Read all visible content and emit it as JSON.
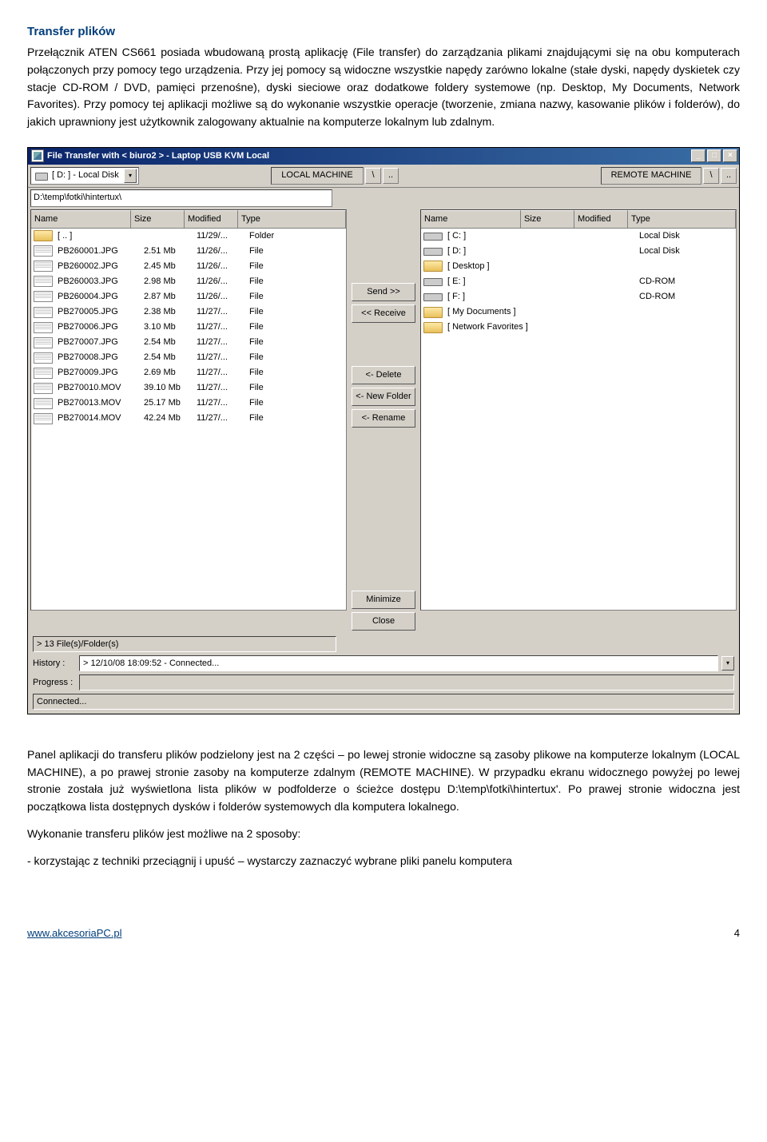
{
  "doc": {
    "heading": "Transfer plików",
    "para1": "Przełącznik ATEN CS661 posiada wbudowaną prostą aplikację (File transfer) do zarządzania plikami znajdującymi się na obu komputerach połączonych przy pomocy tego urządzenia. Przy jej pomocy są widoczne wszystkie napędy zarówno lokalne (stałe dyski, napędy dyskietek czy stacje CD-ROM / DVD, pamięci przenośne), dyski sieciowe oraz dodatkowe foldery systemowe (np. Desktop, My Documents, Network Favorites). Przy pomocy tej aplikacji możliwe są do wykonanie wszystkie operacje (tworzenie, zmiana nazwy, kasowanie plików i folderów), do jakich uprawniony jest użytkownik zalogowany aktualnie na komputerze lokalnym lub zdalnym.",
    "para2": "Panel aplikacji do transferu plików podzielony jest na 2 części – po lewej stronie widoczne są zasoby plikowe na komputerze lokalnym (LOCAL MACHINE), a po prawej stronie zasoby na komputerze zdalnym (REMOTE MACHINE). W przypadku ekranu widocznego powyżej po lewej stronie została już wyświetlona lista plików w podfolderze o ścieżce dostępu D:\\temp\\fotki\\hintertux'. Po prawej stronie widoczna jest początkowa lista dostępnych dysków i folderów systemowych dla komputera lokalnego.",
    "para3": "Wykonanie transferu plików jest możliwe na 2 sposoby:",
    "para4": "- korzystając z techniki przeciągnij i upuść – wystarczy zaznaczyć wybrane pliki panelu komputera",
    "footer_link": "www.akcesoriaPC.pl",
    "footer_page": "4"
  },
  "app": {
    "title": "File Transfer with < biuro2 >  -  Laptop USB KVM Local",
    "combo_local": "[ D: ] - Local Disk",
    "label_local": "LOCAL MACHINE",
    "btn_back": "\\",
    "btn_up": "..",
    "label_remote": "REMOTE MACHINE",
    "path_local": "D:\\temp\\fotki\\hintertux\\",
    "hdr_name": "Name",
    "hdr_size": "Size",
    "hdr_mod": "Modified",
    "hdr_type": "Type",
    "left_rows": [
      {
        "icon": "folder",
        "name": "[ .. ]",
        "size": "",
        "mod": "11/29/...",
        "type": "Folder"
      },
      {
        "icon": "file",
        "name": "PB260001.JPG",
        "size": "2.51 Mb",
        "mod": "11/26/...",
        "type": "File"
      },
      {
        "icon": "file",
        "name": "PB260002.JPG",
        "size": "2.45 Mb",
        "mod": "11/26/...",
        "type": "File"
      },
      {
        "icon": "file",
        "name": "PB260003.JPG",
        "size": "2.98 Mb",
        "mod": "11/26/...",
        "type": "File"
      },
      {
        "icon": "file",
        "name": "PB260004.JPG",
        "size": "2.87 Mb",
        "mod": "11/26/...",
        "type": "File"
      },
      {
        "icon": "file",
        "name": "PB270005.JPG",
        "size": "2.38 Mb",
        "mod": "11/27/...",
        "type": "File"
      },
      {
        "icon": "file",
        "name": "PB270006.JPG",
        "size": "3.10 Mb",
        "mod": "11/27/...",
        "type": "File"
      },
      {
        "icon": "file",
        "name": "PB270007.JPG",
        "size": "2.54 Mb",
        "mod": "11/27/...",
        "type": "File"
      },
      {
        "icon": "file",
        "name": "PB270008.JPG",
        "size": "2.54 Mb",
        "mod": "11/27/...",
        "type": "File"
      },
      {
        "icon": "file",
        "name": "PB270009.JPG",
        "size": "2.69 Mb",
        "mod": "11/27/...",
        "type": "File"
      },
      {
        "icon": "file",
        "name": "PB270010.MOV",
        "size": "39.10 Mb",
        "mod": "11/27/...",
        "type": "File"
      },
      {
        "icon": "file",
        "name": "PB270013.MOV",
        "size": "25.17 Mb",
        "mod": "11/27/...",
        "type": "File"
      },
      {
        "icon": "file",
        "name": "PB270014.MOV",
        "size": "42.24 Mb",
        "mod": "11/27/...",
        "type": "File"
      }
    ],
    "right_rows": [
      {
        "icon": "drive",
        "name": "[ C: ]",
        "size": "",
        "mod": "",
        "type": "Local Disk"
      },
      {
        "icon": "drive",
        "name": "[ D: ]",
        "size": "",
        "mod": "",
        "type": "Local Disk"
      },
      {
        "icon": "folder",
        "name": "[ Desktop ]",
        "size": "",
        "mod": "",
        "type": ""
      },
      {
        "icon": "drive",
        "name": "[ E: ]",
        "size": "",
        "mod": "",
        "type": "CD-ROM"
      },
      {
        "icon": "drive",
        "name": "[ F: ]",
        "size": "",
        "mod": "",
        "type": "CD-ROM"
      },
      {
        "icon": "folder",
        "name": "[ My Documents ]",
        "size": "",
        "mod": "",
        "type": ""
      },
      {
        "icon": "folder",
        "name": "[ Network Favorites ]",
        "size": "",
        "mod": "",
        "type": ""
      }
    ],
    "btn_send": "Send >>",
    "btn_receive": "<< Receive",
    "btn_delete": "<- Delete",
    "btn_newfolder": "<- New Folder",
    "btn_rename": "<- Rename",
    "btn_minimize": "Minimize",
    "btn_close": "Close",
    "status_count": "> 13 File(s)/Folder(s)",
    "history_label": "History :",
    "history_value": "> 12/10/08 18:09:52 - Connected...",
    "progress_label": "Progress :",
    "connected": "Connected..."
  }
}
